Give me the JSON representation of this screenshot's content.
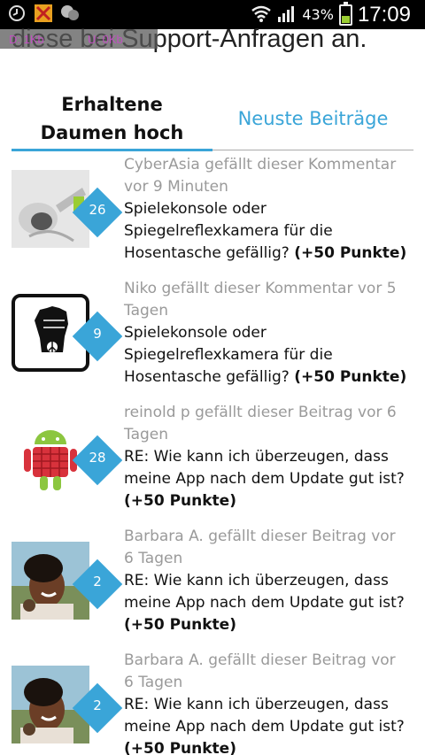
{
  "status_bar": {
    "icons_left": [
      "clock-icon",
      "app-icon",
      "chat-icon"
    ],
    "battery_percent": "43%",
    "battery_level": 0.43,
    "time": "17:09"
  },
  "speed_overlay": {
    "down": "D: 1Kb",
    "up": "U: 0Kb"
  },
  "header": {
    "partial_text": "diese bei Support-Anfragen an."
  },
  "tabs": [
    {
      "label": "Erhaltene Daumen hoch",
      "active": true
    },
    {
      "label": "Neuste Beiträge",
      "active": false
    }
  ],
  "feed": [
    {
      "avatar": "astronaut-avatar",
      "badge": "26",
      "meta": "CyberAsia gefällt dieser Kommentar vor 9 Minuten",
      "title": "Spielekonsole oder Spiegelreflexkamera für die Hosentasche gefällig?",
      "points": "(+50 Punkte)"
    },
    {
      "avatar": "fist-avatar",
      "badge": "9",
      "meta": "Niko gefällt dieser Kommentar vor 5 Tagen",
      "title": "Spielekonsole oder Spiegelreflexkamera für die Hosentasche gefällig?",
      "points": "(+50 Punkte)"
    },
    {
      "avatar": "android-avatar",
      "badge": "28",
      "meta": "reinold p gefällt dieser Beitrag vor 6 Tagen",
      "title": "RE: Wie kann ich überzeugen, dass meine App nach dem Update gut ist?",
      "points": "(+50 Punkte)"
    },
    {
      "avatar": "photo-avatar",
      "badge": "2",
      "meta": "Barbara A. gefällt dieser Beitrag vor 6 Tagen",
      "title": "RE: Wie kann ich überzeugen, dass meine App nach dem Update gut ist?",
      "points": "(+50 Punkte)"
    },
    {
      "avatar": "photo-avatar",
      "badge": "2",
      "meta": "Barbara A. gefällt dieser Beitrag vor 6 Tagen",
      "title": "RE: Wie kann ich überzeugen, dass meine App nach dem Update gut ist?",
      "points": "(+50 Punkte)"
    }
  ],
  "colors": {
    "accent": "#3aa5d8",
    "meta_text": "#9a9a9a"
  }
}
